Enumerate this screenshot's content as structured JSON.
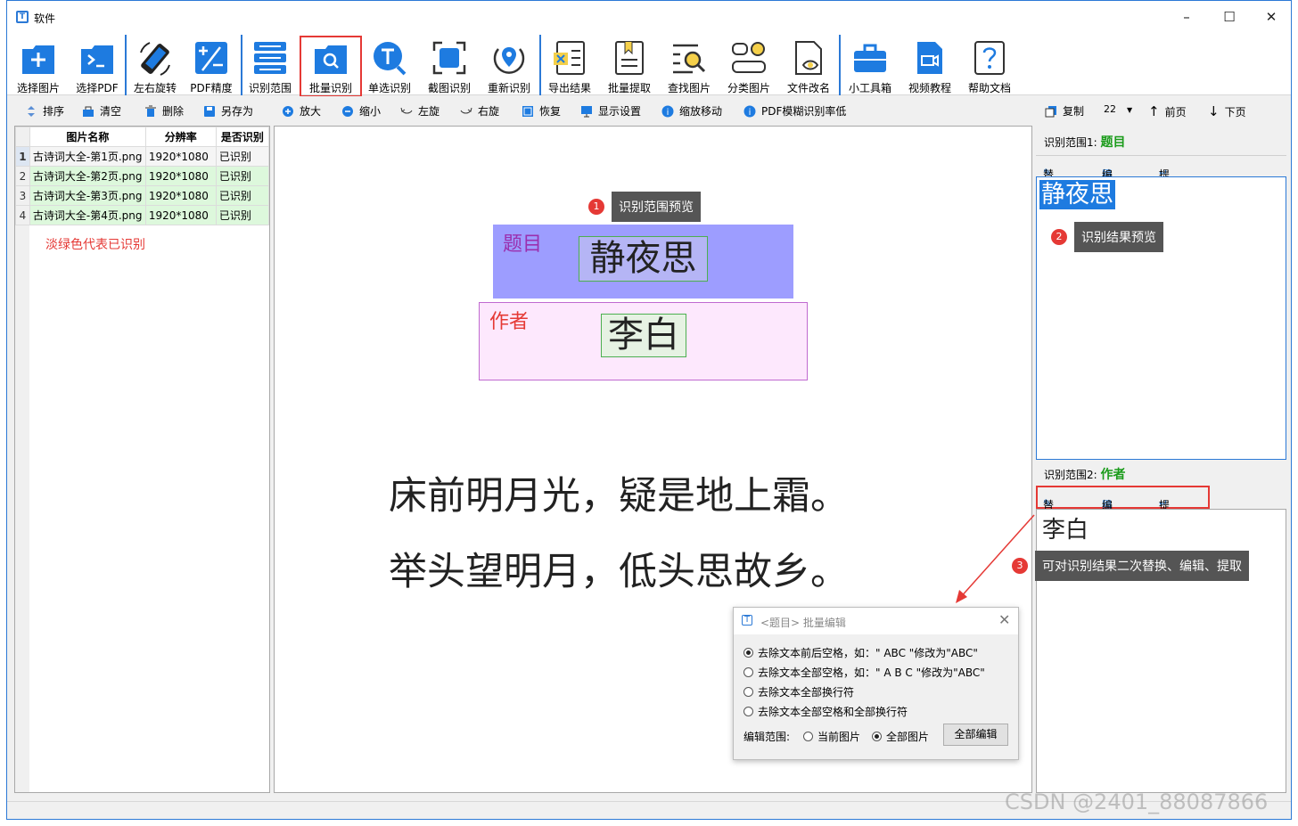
{
  "window": {
    "title": "软件"
  },
  "toolbar": {
    "buttons": [
      {
        "label": "选择图片"
      },
      {
        "label": "选择PDF"
      },
      {
        "label": "左右旋转"
      },
      {
        "label": "PDF精度"
      },
      {
        "label": "识别范围"
      },
      {
        "label": "批量识别"
      },
      {
        "label": "单选识别"
      },
      {
        "label": "截图识别"
      },
      {
        "label": "重新识别"
      },
      {
        "label": "导出结果"
      },
      {
        "label": "批量提取"
      },
      {
        "label": "查找图片"
      },
      {
        "label": "分类图片"
      },
      {
        "label": "文件改名"
      },
      {
        "label": "小工具箱"
      },
      {
        "label": "视频教程"
      },
      {
        "label": "帮助文档"
      }
    ]
  },
  "toolbar2": {
    "sort": "排序",
    "clear": "清空",
    "delete": "删除",
    "save_as": "另存为",
    "zoom_in": "放大",
    "zoom_out": "缩小",
    "rotate_left": "左旋",
    "rotate_right": "右旋",
    "restore": "恢复",
    "display_settings": "显示设置",
    "zoom_move": "缩放移动",
    "pdf_low": "PDF模糊识别率低",
    "copy": "复制",
    "font_size": "22",
    "prev": "前页",
    "next": "下页"
  },
  "table": {
    "headers": [
      "图片名称",
      "分辨率",
      "是否识别"
    ],
    "rows": [
      {
        "num": "1",
        "name": "古诗词大全-第1页.png",
        "res": "1920*1080",
        "status": "已识别"
      },
      {
        "num": "2",
        "name": "古诗词大全-第2页.png",
        "res": "1920*1080",
        "status": "已识别"
      },
      {
        "num": "3",
        "name": "古诗词大全-第3页.png",
        "res": "1920*1080",
        "status": "已识别"
      },
      {
        "num": "4",
        "name": "古诗词大全-第4页.png",
        "res": "1920*1080",
        "status": "已识别"
      }
    ],
    "note": "淡绿色代表已识别"
  },
  "preview": {
    "region1_label": "题目",
    "region1_text": "静夜思",
    "region2_label": "作者",
    "region2_text": "李白",
    "line1": "床前明月光，疑是地上霜。",
    "line2": "举头望明月，低头思故乡。",
    "tip1_num": "1",
    "tip1": "识别范围预览"
  },
  "right": {
    "region1_prefix": "识别范围1:",
    "region1_name": "题目",
    "replace": "替换",
    "edit": "编辑",
    "extract": "提取",
    "result1": "静夜思",
    "tip2_num": "2",
    "tip2": "识别结果预览",
    "region2_prefix": "识别范围2:",
    "region2_name": "作者",
    "result2": "李白",
    "tip3_num": "3",
    "tip3": "可对识别结果二次替换、编辑、提取"
  },
  "dialog": {
    "title": "<题目> 批量编辑",
    "opt1": "去除文本前后空格，如：\" ABC \"修改为\"ABC\"",
    "opt2": "去除文本全部空格，如：\" A B C \"修改为\"ABC\"",
    "opt3": "去除文本全部换行符",
    "opt4": "去除文本全部空格和全部换行符",
    "scope_label": "编辑范围:",
    "scope_current": "当前图片",
    "scope_all": "全部图片",
    "button": "全部编辑"
  },
  "watermark": "CSDN @2401_88087866",
  "colors": {
    "accent": "#2b79d6",
    "highlight_red": "#e53935",
    "recognized_green": "#ddf8dc",
    "region1": "#9d9dff",
    "region2": "#fde8fd"
  }
}
